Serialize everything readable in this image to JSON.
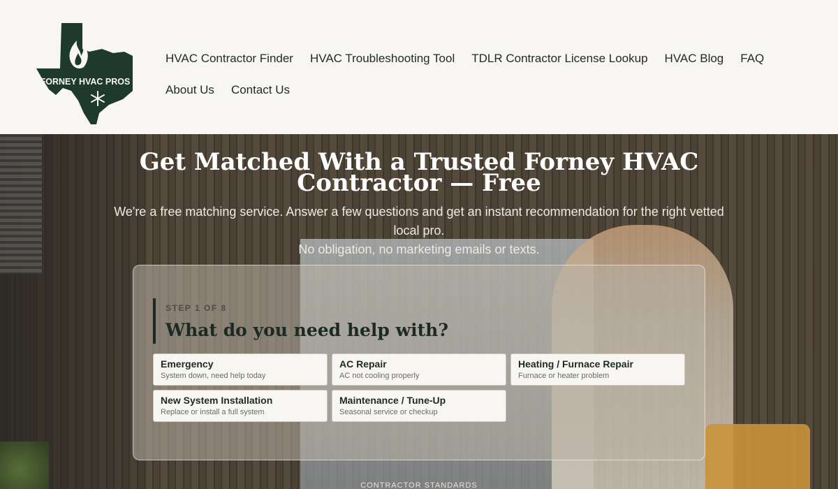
{
  "header": {
    "logo_text": "FORNEY HVAC PROS",
    "logo_icon": "texas-flame-snowflake-logo",
    "nav_items": [
      {
        "label": "HVAC Contractor Finder"
      },
      {
        "label": "HVAC Troubleshooting Tool"
      },
      {
        "label": "TDLR Contractor License Lookup"
      },
      {
        "label": "HVAC Blog"
      },
      {
        "label": "FAQ"
      },
      {
        "label": "About Us"
      },
      {
        "label": "Contact Us"
      }
    ]
  },
  "hero": {
    "title": "Get Matched With a Trusted Forney HVAC Contractor — Free",
    "subtitle_line1": "We're a free matching service. Answer a few questions and get an instant recommendation for the right vetted local pro.",
    "subtitle_line2": "No obligation, no marketing emails or texts."
  },
  "form": {
    "step_label": "STEP 1 OF 8",
    "question": "What do you need help with?",
    "options": [
      {
        "title": "Emergency",
        "desc": "System down, need help today"
      },
      {
        "title": "AC Repair",
        "desc": "AC not cooling properly"
      },
      {
        "title": "Heating / Furnace Repair",
        "desc": "Furnace or heater problem"
      },
      {
        "title": "New System Installation",
        "desc": "Replace or install a full system"
      },
      {
        "title": "Maintenance / Tune-Up",
        "desc": "Seasonal service or checkup"
      }
    ]
  },
  "footer_peek": {
    "label": "CONTRACTOR STANDARDS"
  },
  "colors": {
    "brand_green": "#1d3a2c",
    "header_bg": "#f7f6f2",
    "text_dark": "#1d2a24"
  }
}
